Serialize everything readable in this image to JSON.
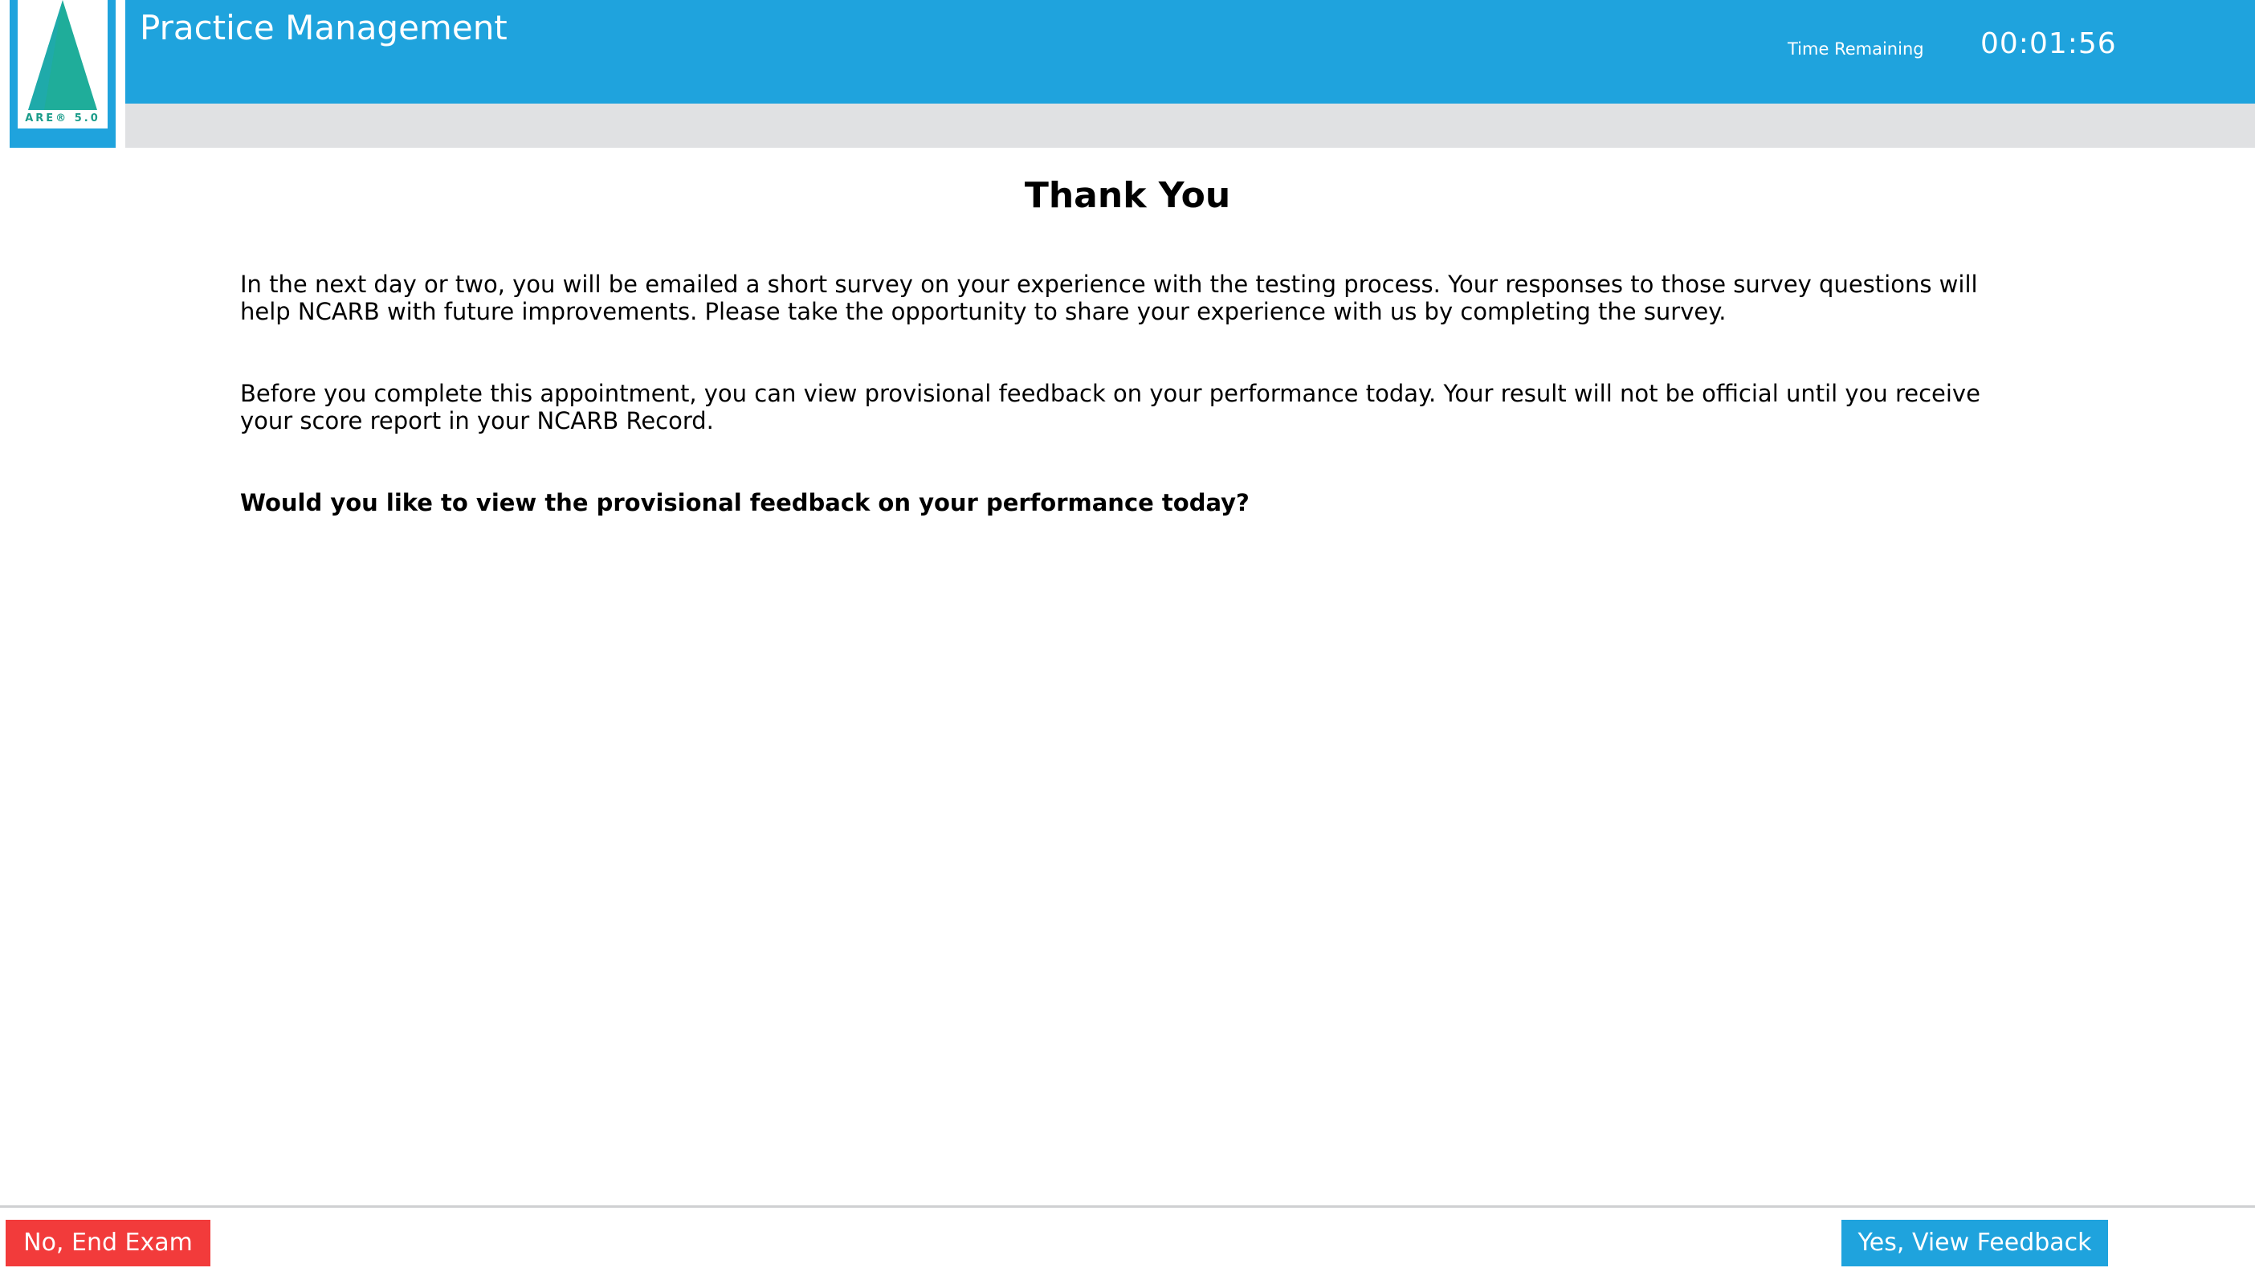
{
  "header": {
    "logo_text": "ARE® 5.0",
    "title": "Practice Management",
    "time_remaining_label": "Time Remaining",
    "time_remaining_value": "00:01:56"
  },
  "main": {
    "heading": "Thank You",
    "paragraph_survey": "In the next day or two, you will be emailed a short survey on your experience with the testing process. Your responses to those survey questions will help NCARB with future improvements. Please take the opportunity to share your experience with us by completing the survey.",
    "paragraph_feedback": "Before you complete this appointment, you can view provisional feedback on your performance today. Your result will not be official until you receive your score report in your NCARB Record.",
    "question": "Would you like to view the provisional feedback on your performance today?"
  },
  "footer": {
    "end_exam_label": "No, End Exam",
    "view_feedback_label": "Yes, View Feedback"
  },
  "colors": {
    "header_blue": "#1fa3dd",
    "subbar_gray": "#e0e1e3",
    "end_exam_red": "#f23b3b",
    "logo_teal": "#1fad9a"
  },
  "icons": {
    "logo": "are-triangle-logo"
  }
}
